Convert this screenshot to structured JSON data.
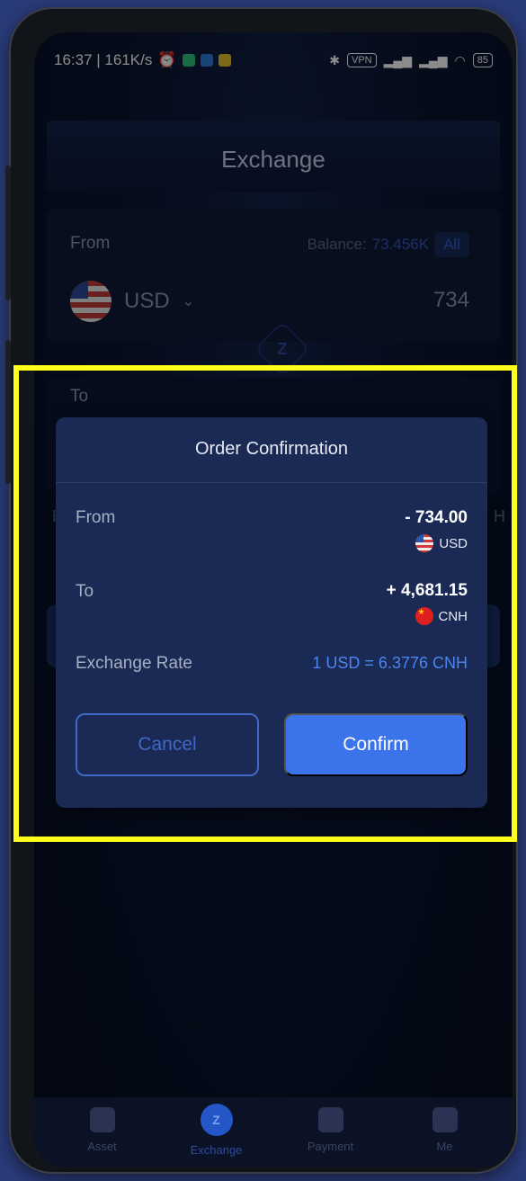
{
  "status_bar": {
    "time_speed": "16:37 | 161K/s",
    "network": "VPN",
    "battery": "85"
  },
  "page": {
    "title": "Exchange"
  },
  "from_section": {
    "label": "From",
    "balance_label": "Balance:",
    "balance_value": "73.456K",
    "all_button": "All",
    "currency": "USD",
    "amount": "734"
  },
  "to_section": {
    "label": "To"
  },
  "background_fragments": {
    "left": "E",
    "right": "H"
  },
  "modal": {
    "title": "Order Confirmation",
    "from_label": "From",
    "from_amount": "- 734.00",
    "from_currency": "USD",
    "to_label": "To",
    "to_amount": "+ 4,681.15",
    "to_currency": "CNH",
    "rate_label": "Exchange Rate",
    "rate_value": "1 USD = 6.3776 CNH",
    "cancel_label": "Cancel",
    "confirm_label": "Confirm"
  },
  "tabbar": {
    "tabs": [
      {
        "label": "Asset",
        "icon": "wallet-icon"
      },
      {
        "label": "Exchange",
        "icon": "exchange-icon",
        "active": true
      },
      {
        "label": "Payment",
        "icon": "card-icon"
      },
      {
        "label": "Me",
        "icon": "user-icon"
      }
    ]
  },
  "colors": {
    "accent": "#3b73ea",
    "highlight": "#ffff1a",
    "modal_bg": "#1a2a54",
    "rate_text": "#4a86f0"
  }
}
